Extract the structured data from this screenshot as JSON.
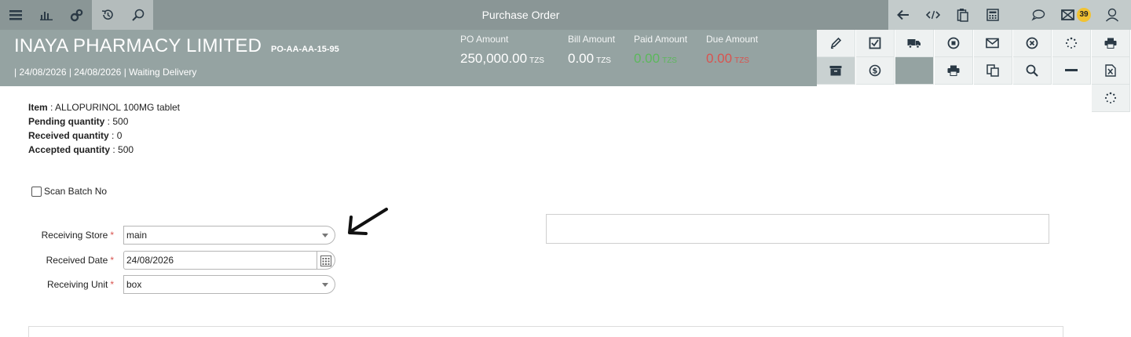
{
  "topbar": {
    "title": "Purchase Order",
    "left_icons": [
      "menu-icon",
      "bar-chart-icon",
      "settings-gears-icon",
      "history-icon",
      "search-icon"
    ],
    "right_icons": [
      "back-arrow-icon",
      "code-icon",
      "clipboard-icon",
      "calculator-icon",
      "chat-icon",
      "mail-icon",
      "user-icon"
    ],
    "notification_count": "39"
  },
  "header": {
    "company": "INAYA PHARMACY LIMITED",
    "po_number": "PO-AA-AA-15-95",
    "subline": "| 24/08/2026 | 24/08/2026 | Waiting Delivery",
    "amounts": [
      {
        "label": "PO Amount",
        "value": "250,000.00",
        "currency": "TZS",
        "color": "#ffffff"
      },
      {
        "label": "Bill Amount",
        "value": "0.00",
        "currency": "TZS",
        "color": "#ffffff"
      },
      {
        "label": "Paid Amount",
        "value": "0.00",
        "currency": "TZS",
        "color": "#5cb85c"
      },
      {
        "label": "Due Amount",
        "value": "0.00",
        "currency": "TZS",
        "color": "#d9534f"
      }
    ]
  },
  "actions": {
    "row1": [
      "edit-pencil-icon",
      "checklist-icon",
      "truck-icon",
      "stop-icon",
      "envelope-icon",
      "cancel-circle-icon",
      "spinner-icon",
      "print-icon"
    ],
    "row2": [
      "archive-icon",
      "dollar-icon",
      "blank",
      "print-icon",
      "copy-icon",
      "search-icon",
      "minus-icon",
      "excel-icon"
    ],
    "row3": [
      "spinner-icon"
    ]
  },
  "item": {
    "item_label": "Item",
    "item_value": "ALLOPURINOL 100MG tablet",
    "pending_label": "Pending quantity",
    "pending_value": "500",
    "received_label": "Received quantity",
    "received_value": "0",
    "accepted_label": "Accepted quantity",
    "accepted_value": "500"
  },
  "scan": {
    "label": "Scan Batch No",
    "checked": false
  },
  "form": {
    "store_label": "Receiving Store",
    "store_value": "main",
    "date_label": "Received Date",
    "date_value": "24/08/2026",
    "unit_label": "Receiving Unit",
    "unit_value": "box",
    "required_mark": "*"
  }
}
